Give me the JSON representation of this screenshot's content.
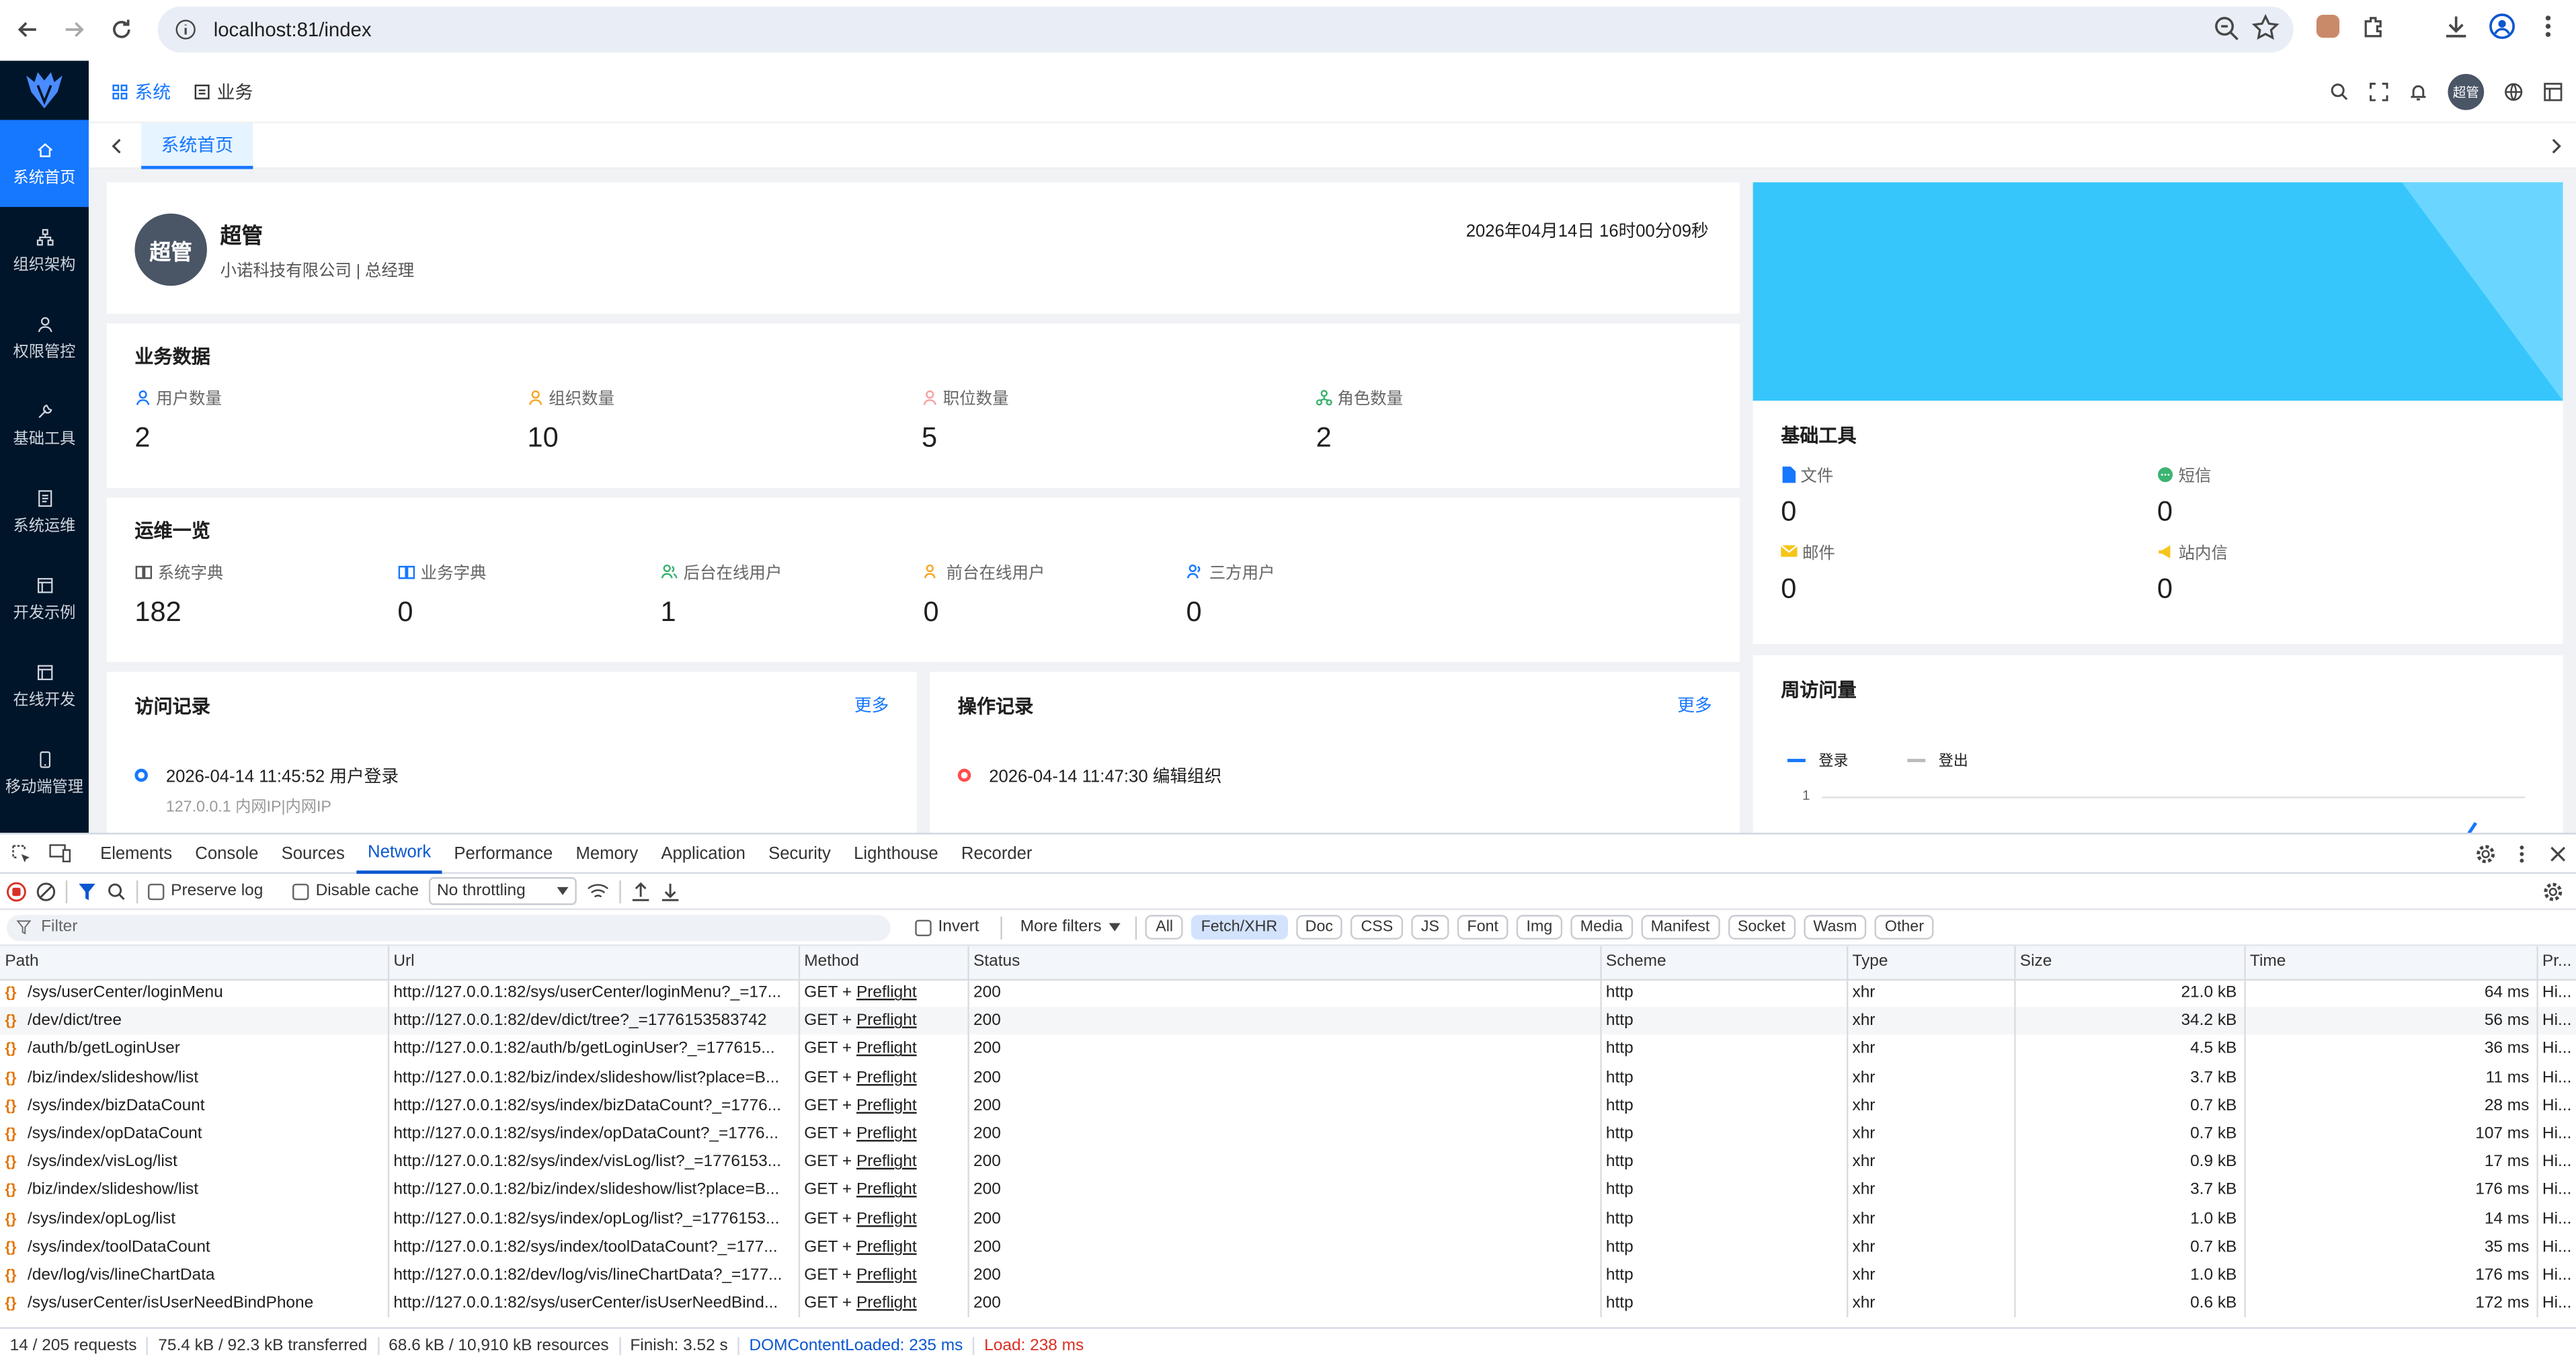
{
  "browser": {
    "url": "localhost:81/index"
  },
  "sidebar": {
    "items": [
      {
        "label": "系统首页",
        "icon": "home-icon"
      },
      {
        "label": "组织架构",
        "icon": "org-icon"
      },
      {
        "label": "权限管控",
        "icon": "user-icon"
      },
      {
        "label": "基础工具",
        "icon": "wrench-icon"
      },
      {
        "label": "系统运维",
        "icon": "doc-icon"
      },
      {
        "label": "开发示例",
        "icon": "window-icon"
      },
      {
        "label": "在线开发",
        "icon": "window-icon"
      },
      {
        "label": "移动端管理",
        "icon": "mobile-icon"
      }
    ]
  },
  "topnav": {
    "items": [
      "系统",
      "业务"
    ],
    "avatar": "超管"
  },
  "tabs": {
    "active": "系统首页"
  },
  "profile": {
    "avatar": "超管",
    "name": "超管",
    "subtitle": "小诺科技有限公司 | 总经理",
    "datetime": "2026年04月14日 16时00分09秒"
  },
  "biz": {
    "title": "业务数据",
    "stats": [
      {
        "label": "用户数量",
        "value": "2"
      },
      {
        "label": "组织数量",
        "value": "10"
      },
      {
        "label": "职位数量",
        "value": "5"
      },
      {
        "label": "角色数量",
        "value": "2"
      }
    ]
  },
  "ops": {
    "title": "运维一览",
    "stats": [
      {
        "label": "系统字典",
        "value": "182"
      },
      {
        "label": "业务字典",
        "value": "0"
      },
      {
        "label": "后台在线用户",
        "value": "1"
      },
      {
        "label": "前台在线用户",
        "value": "0"
      },
      {
        "label": "三方用户",
        "value": "0"
      }
    ]
  },
  "visits": {
    "title": "访问记录",
    "more": "更多",
    "item_title": "2026-04-14 11:45:52 用户登录",
    "item_sub": "127.0.0.1 内网IP|内网IP"
  },
  "oplog": {
    "title": "操作记录",
    "more": "更多",
    "item_title": "2026-04-14 11:47:30 编辑组织"
  },
  "tools": {
    "title": "基础工具",
    "stats": [
      {
        "label": "文件",
        "value": "0"
      },
      {
        "label": "短信",
        "value": "0"
      },
      {
        "label": "邮件",
        "value": "0"
      },
      {
        "label": "站内信",
        "value": "0"
      }
    ]
  },
  "weekly": {
    "title": "周访问量",
    "legend": [
      "登录",
      "登出"
    ],
    "y_tick": "1"
  },
  "devtools": {
    "tabs": [
      "Elements",
      "Console",
      "Sources",
      "Network",
      "Performance",
      "Memory",
      "Application",
      "Security",
      "Lighthouse",
      "Recorder"
    ],
    "active_tab": "Network",
    "toolbar": {
      "preserve_log": "Preserve log",
      "disable_cache": "Disable cache",
      "throttling": "No throttling"
    },
    "filter": {
      "placeholder": "Filter",
      "invert": "Invert",
      "more_filters": "More filters",
      "types": [
        "All",
        "Fetch/XHR",
        "Doc",
        "CSS",
        "JS",
        "Font",
        "Img",
        "Media",
        "Manifest",
        "Socket",
        "Wasm",
        "Other"
      ],
      "active_type": "Fetch/XHR"
    },
    "columns": [
      "Path",
      "Url",
      "Method",
      "Status",
      "Scheme",
      "Type",
      "Size",
      "Time",
      "Pr..."
    ],
    "rows": [
      {
        "path": "/sys/userCenter/loginMenu",
        "url": "http://127.0.0.1:82/sys/userCenter/loginMenu?_=17...",
        "method": "GET + ",
        "preflight": "Preflight",
        "status": "200",
        "scheme": "http",
        "type": "xhr",
        "size": "21.0 kB",
        "time": "64 ms",
        "pr": "Hi..."
      },
      {
        "path": "/dev/dict/tree",
        "url": "http://127.0.0.1:82/dev/dict/tree?_=1776153583742",
        "method": "GET + ",
        "preflight": "Preflight",
        "status": "200",
        "scheme": "http",
        "type": "xhr",
        "size": "34.2 kB",
        "time": "56 ms",
        "pr": "Hi..."
      },
      {
        "path": "/auth/b/getLoginUser",
        "url": "http://127.0.0.1:82/auth/b/getLoginUser?_=177615...",
        "method": "GET + ",
        "preflight": "Preflight",
        "status": "200",
        "scheme": "http",
        "type": "xhr",
        "size": "4.5 kB",
        "time": "36 ms",
        "pr": "Hi..."
      },
      {
        "path": "/biz/index/slideshow/list",
        "url": "http://127.0.0.1:82/biz/index/slideshow/list?place=B...",
        "method": "GET + ",
        "preflight": "Preflight",
        "status": "200",
        "scheme": "http",
        "type": "xhr",
        "size": "3.7 kB",
        "time": "11 ms",
        "pr": "Hi..."
      },
      {
        "path": "/sys/index/bizDataCount",
        "url": "http://127.0.0.1:82/sys/index/bizDataCount?_=1776...",
        "method": "GET + ",
        "preflight": "Preflight",
        "status": "200",
        "scheme": "http",
        "type": "xhr",
        "size": "0.7 kB",
        "time": "28 ms",
        "pr": "Hi..."
      },
      {
        "path": "/sys/index/opDataCount",
        "url": "http://127.0.0.1:82/sys/index/opDataCount?_=1776...",
        "method": "GET + ",
        "preflight": "Preflight",
        "status": "200",
        "scheme": "http",
        "type": "xhr",
        "size": "0.7 kB",
        "time": "107 ms",
        "pr": "Hi..."
      },
      {
        "path": "/sys/index/visLog/list",
        "url": "http://127.0.0.1:82/sys/index/visLog/list?_=1776153...",
        "method": "GET + ",
        "preflight": "Preflight",
        "status": "200",
        "scheme": "http",
        "type": "xhr",
        "size": "0.9 kB",
        "time": "17 ms",
        "pr": "Hi..."
      },
      {
        "path": "/biz/index/slideshow/list",
        "url": "http://127.0.0.1:82/biz/index/slideshow/list?place=B...",
        "method": "GET + ",
        "preflight": "Preflight",
        "status": "200",
        "scheme": "http",
        "type": "xhr",
        "size": "3.7 kB",
        "time": "176 ms",
        "pr": "Hi..."
      },
      {
        "path": "/sys/index/opLog/list",
        "url": "http://127.0.0.1:82/sys/index/opLog/list?_=1776153...",
        "method": "GET + ",
        "preflight": "Preflight",
        "status": "200",
        "scheme": "http",
        "type": "xhr",
        "size": "1.0 kB",
        "time": "14 ms",
        "pr": "Hi..."
      },
      {
        "path": "/sys/index/toolDataCount",
        "url": "http://127.0.0.1:82/sys/index/toolDataCount?_=177...",
        "method": "GET + ",
        "preflight": "Preflight",
        "status": "200",
        "scheme": "http",
        "type": "xhr",
        "size": "0.7 kB",
        "time": "35 ms",
        "pr": "Hi..."
      },
      {
        "path": "/dev/log/vis/lineChartData",
        "url": "http://127.0.0.1:82/dev/log/vis/lineChartData?_=177...",
        "method": "GET + ",
        "preflight": "Preflight",
        "status": "200",
        "scheme": "http",
        "type": "xhr",
        "size": "1.0 kB",
        "time": "176 ms",
        "pr": "Hi..."
      },
      {
        "path": "/sys/userCenter/isUserNeedBindPhone",
        "url": "http://127.0.0.1:82/sys/userCenter/isUserNeedBind...",
        "method": "GET + ",
        "preflight": "Preflight",
        "status": "200",
        "scheme": "http",
        "type": "xhr",
        "size": "0.6 kB",
        "time": "172 ms",
        "pr": "Hi..."
      }
    ],
    "status": {
      "requests": "14 / 205 requests",
      "transferred": "75.4 kB / 92.3 kB transferred",
      "resources": "68.6 kB / 10,910 kB resources",
      "finish": "Finish: 3.52 s",
      "dcl": "DOMContentLoaded: 235 ms",
      "load": "Load: 238 ms"
    }
  }
}
